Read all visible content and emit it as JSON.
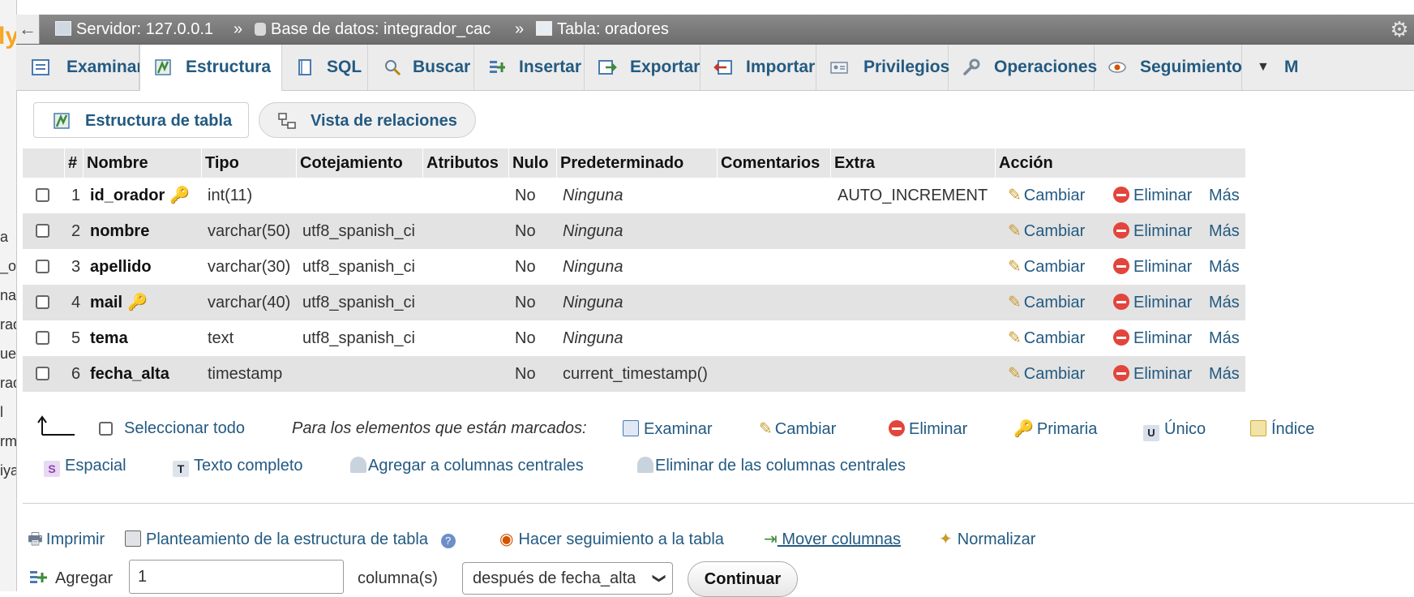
{
  "breadcrumb": {
    "back_label": "←",
    "server": "Servidor: 127.0.0.1",
    "database": "Base de datos: integrador_cac",
    "table": "Tabla: oradores",
    "separator": "»"
  },
  "left_fragments": [
    "a",
    "_ol",
    "na",
    "rad",
    "ue",
    "rad",
    "l",
    "rm",
    "iya"
  ],
  "tabs": [
    {
      "label": "Examinar",
      "icon": "browse-icon"
    },
    {
      "label": "Estructura",
      "icon": "structure-icon",
      "active": true
    },
    {
      "label": "SQL",
      "icon": "sql-icon"
    },
    {
      "label": "Buscar",
      "icon": "search-icon"
    },
    {
      "label": "Insertar",
      "icon": "insert-icon"
    },
    {
      "label": "Exportar",
      "icon": "export-icon"
    },
    {
      "label": "Importar",
      "icon": "import-icon"
    },
    {
      "label": "Privilegios",
      "icon": "privileges-icon"
    },
    {
      "label": "Operaciones",
      "icon": "wrench-icon"
    },
    {
      "label": "Seguimiento",
      "icon": "eye-icon"
    },
    {
      "label": "M",
      "icon": "more-icon"
    }
  ],
  "subtabs": {
    "structure": "Estructura de tabla",
    "relations": "Vista de relaciones"
  },
  "columns": [
    "#",
    "Nombre",
    "Tipo",
    "Cotejamiento",
    "Atributos",
    "Nulo",
    "Predeterminado",
    "Comentarios",
    "Extra",
    "Acción"
  ],
  "rows": [
    {
      "num": "1",
      "name": "id_orador",
      "key": "primary",
      "type": "int(11)",
      "collation": "",
      "null": "No",
      "default": "Ninguna",
      "default_italic": true,
      "extra": "AUTO_INCREMENT"
    },
    {
      "num": "2",
      "name": "nombre",
      "key": "",
      "type": "varchar(50)",
      "collation": "utf8_spanish_ci",
      "null": "No",
      "default": "Ninguna",
      "default_italic": true,
      "extra": ""
    },
    {
      "num": "3",
      "name": "apellido",
      "key": "",
      "type": "varchar(30)",
      "collation": "utf8_spanish_ci",
      "null": "No",
      "default": "Ninguna",
      "default_italic": true,
      "extra": ""
    },
    {
      "num": "4",
      "name": "mail",
      "key": "unique",
      "type": "varchar(40)",
      "collation": "utf8_spanish_ci",
      "null": "No",
      "default": "Ninguna",
      "default_italic": true,
      "extra": ""
    },
    {
      "num": "5",
      "name": "tema",
      "key": "",
      "type": "text",
      "collation": "utf8_spanish_ci",
      "null": "No",
      "default": "Ninguna",
      "default_italic": true,
      "extra": ""
    },
    {
      "num": "6",
      "name": "fecha_alta",
      "key": "",
      "type": "timestamp",
      "collation": "",
      "null": "No",
      "default": "current_timestamp()",
      "default_italic": false,
      "extra": ""
    }
  ],
  "row_actions": {
    "change": "Cambiar",
    "drop": "Eliminar",
    "more": "Más"
  },
  "bulk": {
    "select_all": "Seleccionar todo",
    "with_selected": "Para los elementos que están marcados:",
    "browse": "Examinar",
    "change": "Cambiar",
    "drop": "Eliminar",
    "primary": "Primaria",
    "unique": "Único",
    "index": "Índice",
    "spatial": "Espacial",
    "fulltext": "Texto completo",
    "add_central": "Agregar a columnas centrales",
    "remove_central": "Eliminar de las columnas centrales"
  },
  "footer": {
    "print": "Imprimir",
    "propose": "Planteamiento de la estructura de tabla",
    "track": "Hacer seguimiento a la tabla",
    "move": " Mover columnas ",
    "normalize": "Normalizar",
    "add_label": "Agregar",
    "add_value": "1",
    "columns_label": "columna(s)",
    "position_value": "después de fecha_alta",
    "go": "Continuar"
  },
  "colors": {
    "link": "#235a81",
    "topbar": "#7a7a7a",
    "row_alt": "#e3e3e3",
    "drop_red": "#e2453c",
    "logo": "#f6a623"
  }
}
